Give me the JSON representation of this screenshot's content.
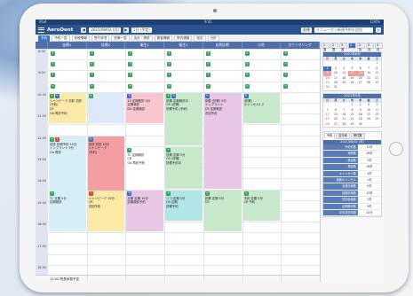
{
  "app": {
    "brand": "AeroDent",
    "date_display": "2021/08/02 (月)",
    "view_select": "1日 (予定)",
    "clinic_select": "医療",
    "search_placeholder": "メニューから新規予約を追加"
  },
  "status_bar": {
    "left": "iPad",
    "center": "9:41",
    "right": "100%"
  },
  "toolbar": {
    "buttons": [
      "予約",
      "予約一覧",
      "診療情報",
      "受付状況",
      "診療一覧",
      "会計・請求",
      "患者情報",
      "院内連絡",
      "設定",
      "分析"
    ]
  },
  "schedule": {
    "columns": [
      "診療1",
      "診療2",
      "衛生1",
      "衛生2",
      "自費診療",
      "小児",
      "カウンセリング"
    ],
    "times": [
      "8:00",
      "",
      "9:00",
      "",
      "10:00",
      "",
      "11:00",
      "",
      "12:00",
      "",
      "13:00",
      "",
      "14:00",
      "",
      "15:00",
      "",
      "16:00",
      "",
      "17:00",
      "",
      "18:00"
    ],
    "events": [
      {
        "col": 0,
        "row": 4,
        "span": 3,
        "color": "#fbe9a7",
        "lines": [
          "シャンビーク 初診 初診",
          "(予約)",
          "CP",
          "OA 再診予約"
        ],
        "badges": [
          "g",
          "b"
        ]
      },
      {
        "col": 1,
        "row": 4,
        "span": 3,
        "color": "#dce9f8",
        "lines": [
          "",
          "",
          "",
          ""
        ],
        "badges": [
          "g"
        ]
      },
      {
        "col": 2,
        "row": 4,
        "span": 3,
        "color": "#f7c6cf",
        "lines": [
          "15 定期検診 5分",
          "定期検診",
          "DH 定期検診"
        ],
        "badges": [
          "b"
        ]
      },
      {
        "col": 3,
        "row": 4,
        "span": 5,
        "color": "#c7e8cb",
        "lines": [
          "診察 定期検診中",
          "CR (診察)",
          "診察予約 (予約)"
        ],
        "badges": [
          "g",
          "b"
        ]
      },
      {
        "col": 4,
        "row": 4,
        "span": 9,
        "color": "#e8c7e4",
        "lines": [
          "伊藤 (診察) 5分",
          "インプラント",
          "CR 定期検診",
          "次回予約"
        ],
        "badges": [
          "b"
        ]
      },
      {
        "col": 5,
        "row": 4,
        "span": 3,
        "color": "#c7e8cb",
        "lines": [
          "(診察)",
          "キャンセル1 2"
        ],
        "badges": [
          "b"
        ]
      },
      {
        "col": 0,
        "row": 8,
        "span": 6,
        "color": "#d7eef7",
        "lines": [
          "初診 診療予約 10分",
          "インプラント 5分",
          "OA 再診"
        ],
        "badges": [
          "g",
          "r"
        ]
      },
      {
        "col": 1,
        "row": 8,
        "span": 9,
        "color": "#f39ea2",
        "lines": [
          "初診 初診 10分",
          "シャンビーク",
          "(予約)"
        ],
        "badges": [
          "b"
        ]
      },
      {
        "col": 2,
        "row": 9,
        "span": 4,
        "color": "#fff",
        "lines": [
          "TC 定期検診",
          "CR",
          "OA 再診予約"
        ],
        "badges": [
          "g"
        ]
      },
      {
        "col": 3,
        "row": 9,
        "span": 4,
        "color": "#c7e8cb",
        "lines": [
          "診察 定期 5分",
          "CR (診察)",
          "診察予約中"
        ],
        "badges": [
          "g"
        ]
      },
      {
        "col": 0,
        "row": 13,
        "span": 4,
        "color": "#d7eef7",
        "lines": [
          "TC 定期 5分",
          "定期検診"
        ],
        "badges": [
          "g"
        ]
      },
      {
        "col": 1,
        "row": 13,
        "span": 4,
        "color": "#fbe9a7",
        "lines": [
          "シャンビーク 10分",
          "CR",
          "次回予約"
        ],
        "badges": [
          "r"
        ]
      },
      {
        "col": 2,
        "row": 13,
        "span": 4,
        "color": "#e8c7e4",
        "lines": [
          "定期 定期 10分",
          "定期検診予約"
        ],
        "badges": [
          "b"
        ]
      },
      {
        "col": 3,
        "row": 13,
        "span": 3,
        "color": "#b2e6e6",
        "lines": [
          "ニコ 定期 5分",
          "CR 定期",
          "診察予約"
        ],
        "badges": [
          "g"
        ]
      },
      {
        "col": 4,
        "row": 13,
        "span": 4,
        "color": "#c7e8cb",
        "lines": [
          "診察 定期 5分",
          "CR"
        ],
        "badges": [
          "g"
        ]
      },
      {
        "col": 5,
        "row": 13,
        "span": 3,
        "color": "#c7e8cb",
        "lines": [
          "予約 定期 5分",
          "CR 予約"
        ],
        "badges": [
          "g"
        ]
      }
    ],
    "footer_note": "12:00  院長休憩予定"
  },
  "side": {
    "tabs": [
      "1週",
      "2週",
      "3週",
      "1月",
      "2月",
      "3月",
      "4月"
    ],
    "cal1_title": "2021年8月",
    "cal2_title": "2021年9月",
    "dow": [
      "日",
      "月",
      "火",
      "水",
      "木",
      "金",
      "土"
    ],
    "cal1_days": [
      "",
      "",
      "",
      "",
      "",
      "",
      "1",
      "2",
      "3",
      "4",
      "5",
      "6",
      "7",
      "8",
      "9",
      "10",
      "11",
      "12",
      "13",
      "14",
      "15",
      "16",
      "17",
      "18",
      "19",
      "20",
      "21",
      "22",
      "23",
      "24",
      "25",
      "26",
      "27",
      "28",
      "29",
      "30",
      "31",
      "",
      "",
      "",
      ""
    ],
    "cal2_days": [
      "",
      "",
      "",
      "1",
      "2",
      "3",
      "4",
      "5",
      "6",
      "7",
      "8",
      "9",
      "10",
      "11",
      "12",
      "13",
      "14",
      "15",
      "16",
      "17",
      "18",
      "19",
      "20",
      "21",
      "22",
      "23",
      "24",
      "25",
      "26",
      "27",
      "28",
      "29",
      "30",
      "",
      ""
    ],
    "panel_tabs": [
      "予約",
      "空き枠",
      "受付数"
    ],
    "panel_title": "2021/08/02 (月)",
    "stats": [
      {
        "k": "予約件数",
        "v": "31件"
      },
      {
        "k": "来院数",
        "v": "28件"
      },
      {
        "k": "新患数",
        "v": "2件"
      },
      {
        "k": "再診数",
        "v": "26件"
      },
      {
        "k": "キャンセル数",
        "v": "3件"
      },
      {
        "k": "無断キャンセル",
        "v": "1件"
      },
      {
        "k": "自費診療数",
        "v": "5件"
      },
      {
        "k": "保険診療数",
        "v": "23件"
      },
      {
        "k": "初診患者数",
        "v": "2件"
      },
      {
        "k": "定期検診数",
        "v": "9件"
      },
      {
        "k": "平均滞在時間",
        "v": "42分"
      }
    ]
  }
}
